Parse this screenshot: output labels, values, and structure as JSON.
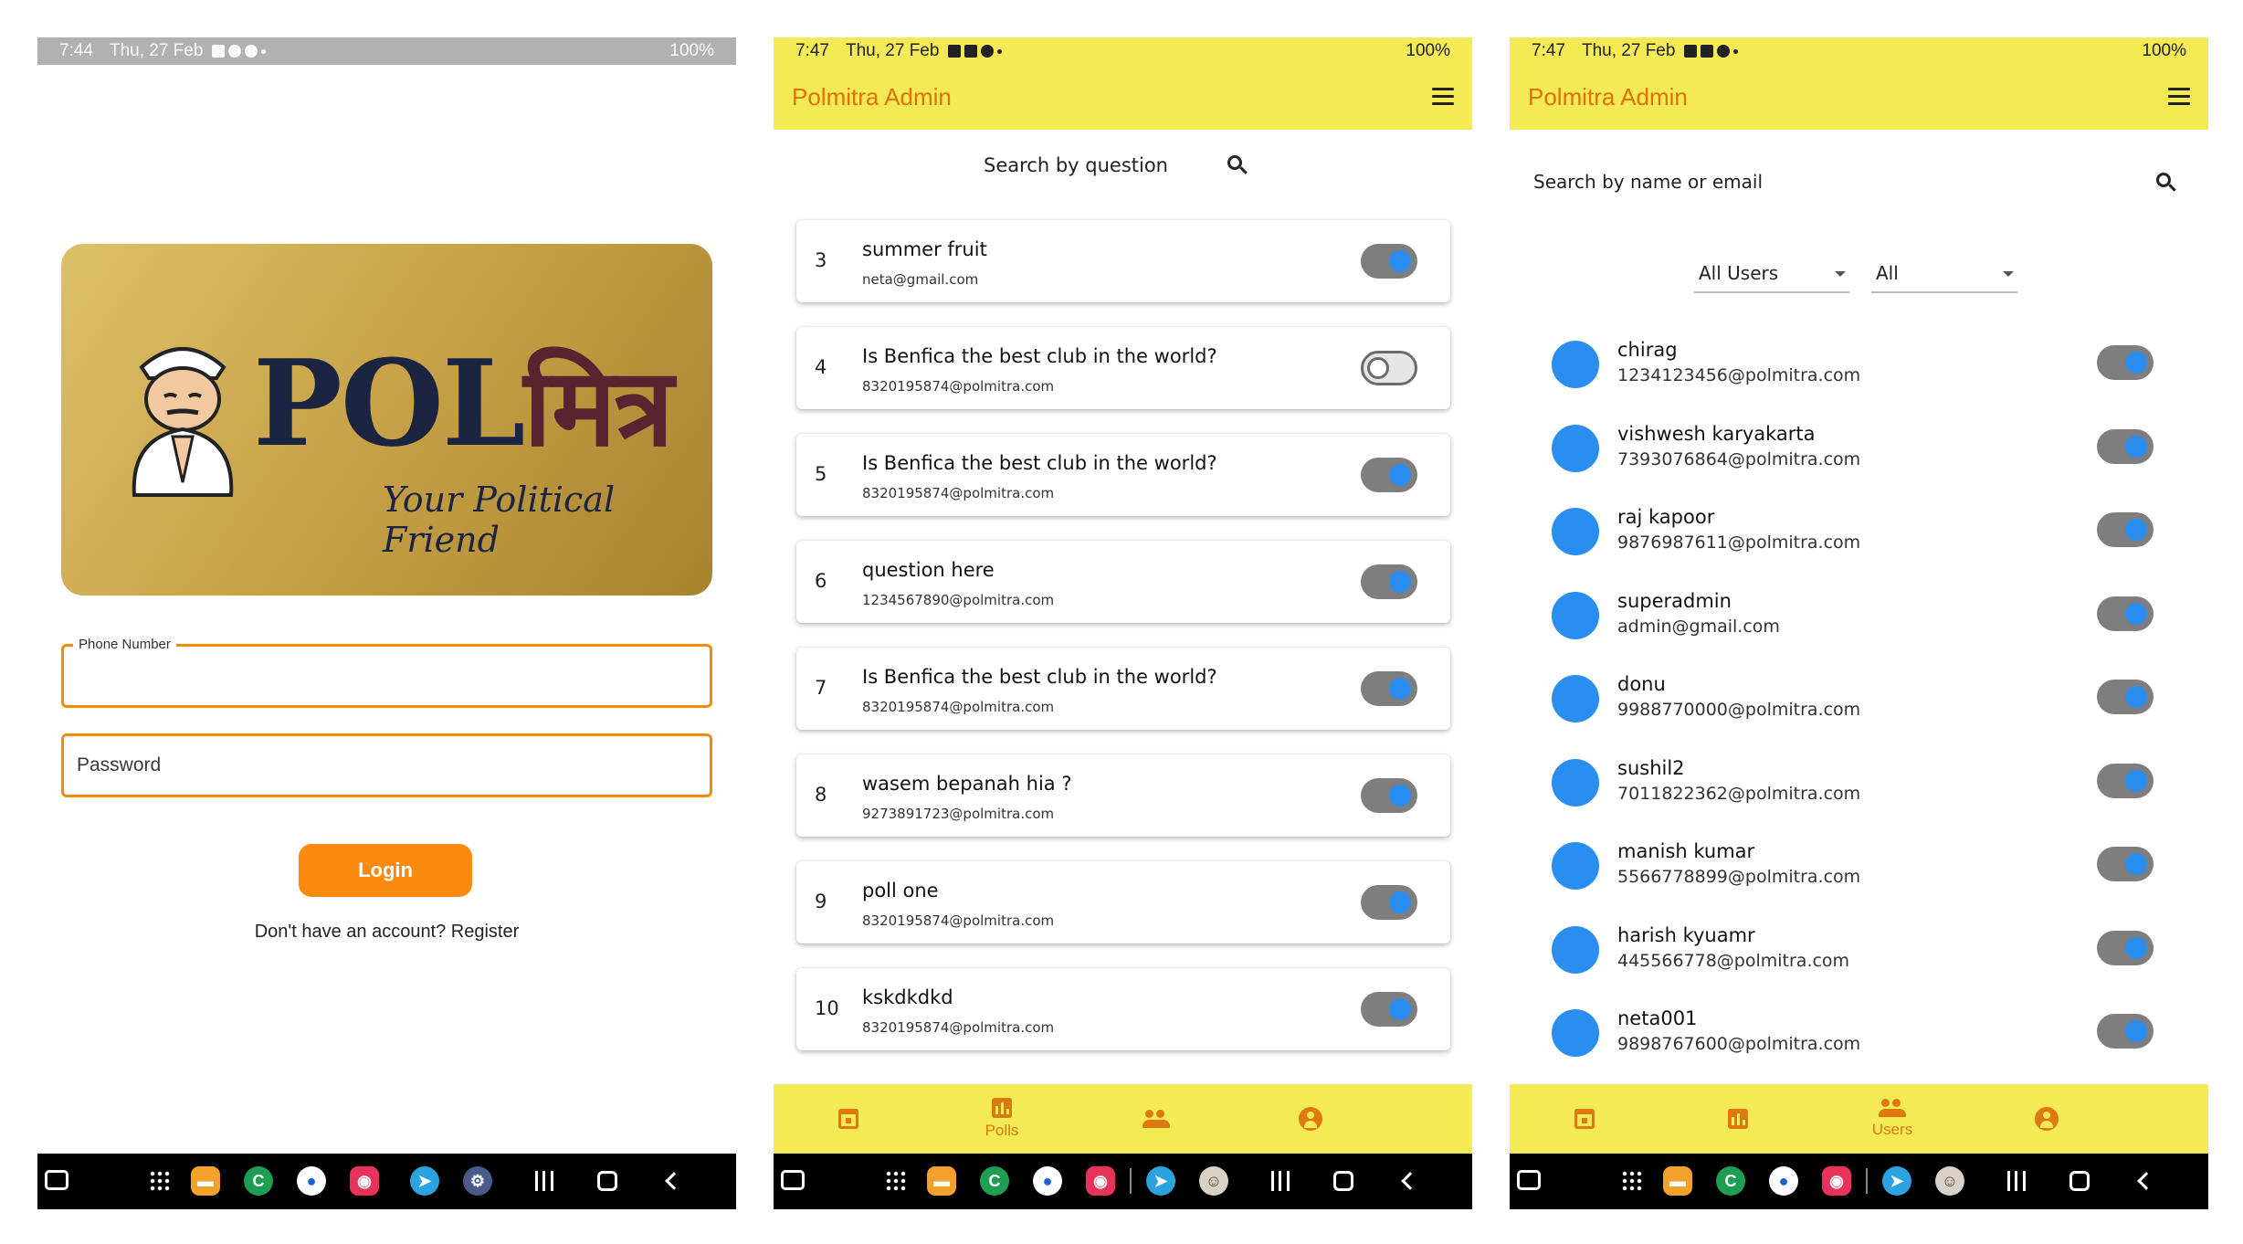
{
  "screens": {
    "login": {
      "status": {
        "time": "7:44",
        "date": "Thu, 27 Feb",
        "battery": "100%"
      },
      "logo": {
        "word": "POL",
        "hindi": "मित्र",
        "tagline": "Your Political Friend"
      },
      "phone_label": "Phone Number",
      "phone_value": "",
      "password_placeholder": "Password",
      "login_label": "Login",
      "register_text": "Don't have an account? Register"
    },
    "polls": {
      "status": {
        "time": "7:47",
        "date": "Thu, 27 Feb",
        "battery": "100%"
      },
      "title": "Polmitra Admin",
      "search_placeholder": "Search by question",
      "items": [
        {
          "num": "3",
          "question": "summer fruit",
          "email": "neta@gmail.com",
          "active": true
        },
        {
          "num": "4",
          "question": "Is Benfica the best club in the world?",
          "email": "8320195874@polmitra.com",
          "active": false
        },
        {
          "num": "5",
          "question": "Is Benfica the best club in the world?",
          "email": "8320195874@polmitra.com",
          "active": true
        },
        {
          "num": "6",
          "question": "question here",
          "email": "1234567890@polmitra.com",
          "active": true
        },
        {
          "num": "7",
          "question": "Is Benfica the best club in the world?",
          "email": "8320195874@polmitra.com",
          "active": true
        },
        {
          "num": "8",
          "question": "wasem bepanah hia ?",
          "email": "9273891723@polmitra.com",
          "active": true
        },
        {
          "num": "9",
          "question": "poll one",
          "email": "8320195874@polmitra.com",
          "active": true
        },
        {
          "num": "10",
          "question": "kskdkdkd",
          "email": "8320195874@polmitra.com",
          "active": true
        }
      ],
      "nav": [
        {
          "icon": "calendar-icon",
          "label": ""
        },
        {
          "icon": "poll-icon",
          "label": "Polls",
          "active": true
        },
        {
          "icon": "people-icon",
          "label": ""
        },
        {
          "icon": "account-icon",
          "label": ""
        }
      ]
    },
    "users": {
      "status": {
        "time": "7:47",
        "date": "Thu, 27 Feb",
        "battery": "100%"
      },
      "title": "Polmitra Admin",
      "search_placeholder": "Search by name or email",
      "role_filter": "All Users",
      "status_filter": "All",
      "items": [
        {
          "name": "chirag",
          "email": "1234123456@polmitra.com",
          "active": true
        },
        {
          "name": "vishwesh karyakarta",
          "email": "7393076864@polmitra.com",
          "active": true
        },
        {
          "name": "raj kapoor",
          "email": "9876987611@polmitra.com",
          "active": true
        },
        {
          "name": "superadmin",
          "email": "admin@gmail.com",
          "active": true
        },
        {
          "name": "donu",
          "email": "9988770000@polmitra.com",
          "active": true
        },
        {
          "name": "sushil2",
          "email": "7011822362@polmitra.com",
          "active": true
        },
        {
          "name": "manish kumar",
          "email": "5566778899@polmitra.com",
          "active": true
        },
        {
          "name": "harish kyuamr",
          "email": "445566778@polmitra.com",
          "active": true
        },
        {
          "name": "neta001",
          "email": "9898767600@polmitra.com",
          "active": true
        }
      ],
      "nav": [
        {
          "icon": "calendar-icon",
          "label": ""
        },
        {
          "icon": "poll-icon",
          "label": ""
        },
        {
          "icon": "people-icon",
          "label": "Users",
          "active": true
        },
        {
          "icon": "account-icon",
          "label": ""
        }
      ]
    }
  },
  "colors": {
    "accent": "#f3ea55",
    "brand_orange": "#fb8a10",
    "toggle_on": "#2a8df0",
    "avatar": "#2a8df0"
  },
  "taskbar_apps": [
    "screen-recorder-icon",
    "app-drawer-icon",
    "files-app-icon",
    "phone-app-icon",
    "messages-app-icon",
    "camera-app-icon",
    "telegram-app-icon",
    "settings-app-icon"
  ]
}
